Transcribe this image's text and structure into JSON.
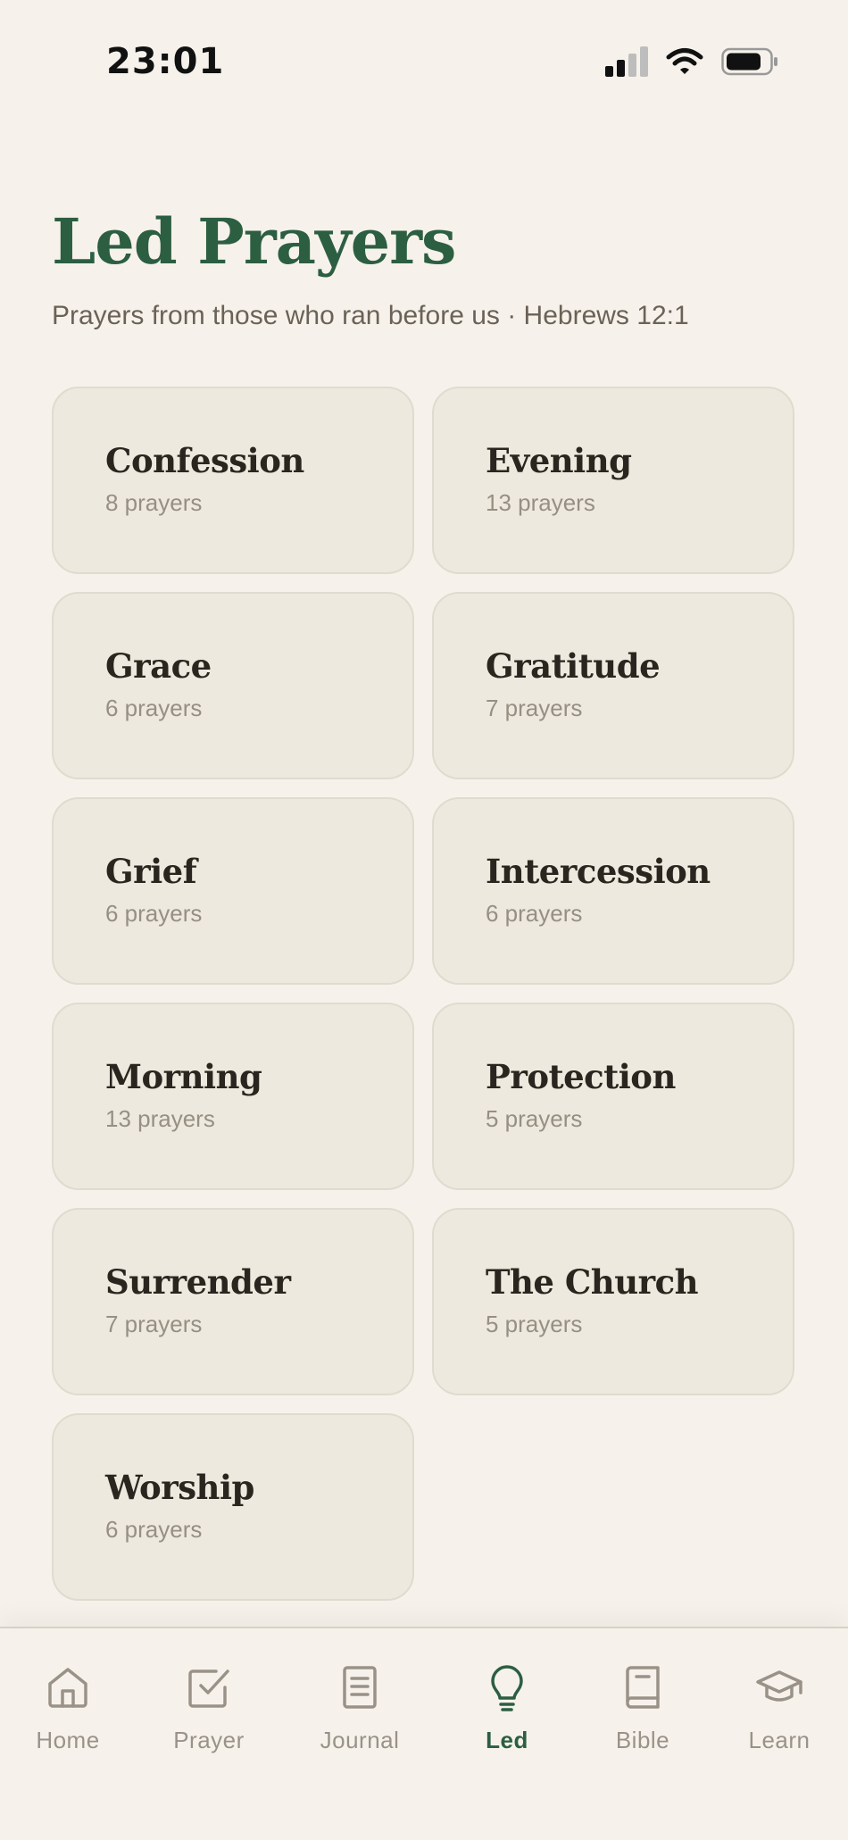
{
  "status_bar": {
    "time": "23:01"
  },
  "header": {
    "title": "Led Prayers",
    "subtitle": "Prayers from those who ran before us · Hebrews 12:1"
  },
  "categories": [
    {
      "name": "Confession",
      "count": "8 prayers"
    },
    {
      "name": "Evening",
      "count": "13 prayers"
    },
    {
      "name": "Grace",
      "count": "6 prayers"
    },
    {
      "name": "Gratitude",
      "count": "7 prayers"
    },
    {
      "name": "Grief",
      "count": "6 prayers"
    },
    {
      "name": "Intercession",
      "count": "6 prayers"
    },
    {
      "name": "Morning",
      "count": "13 prayers"
    },
    {
      "name": "Protection",
      "count": "5 prayers"
    },
    {
      "name": "Surrender",
      "count": "7 prayers"
    },
    {
      "name": "The Church",
      "count": "5 prayers"
    },
    {
      "name": "Worship",
      "count": "6 prayers"
    }
  ],
  "tabs": [
    {
      "label": "Home",
      "icon": "home-icon"
    },
    {
      "label": "Prayer",
      "icon": "checkbox-icon"
    },
    {
      "label": "Journal",
      "icon": "journal-icon"
    },
    {
      "label": "Led",
      "icon": "lightbulb-icon",
      "active": true
    },
    {
      "label": "Bible",
      "icon": "book-icon"
    },
    {
      "label": "Learn",
      "icon": "graduation-cap-icon"
    }
  ],
  "colors": {
    "accent": "#2c5e42",
    "background": "#f6f2eb",
    "card": "#ede9de",
    "inactive": "#9a9288"
  }
}
